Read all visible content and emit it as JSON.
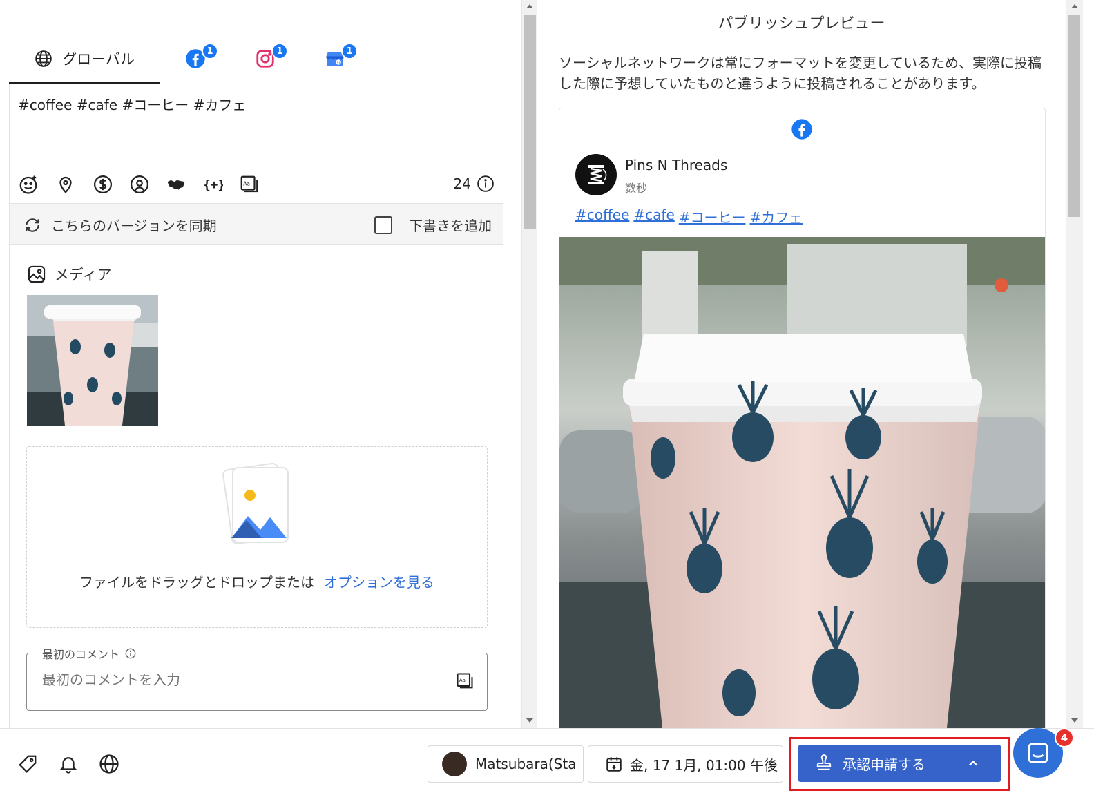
{
  "tabs": {
    "global_label": "グローバル",
    "facebook_badge": "1",
    "instagram_badge": "1",
    "google_badge": "1"
  },
  "editor": {
    "post_text": "#coffee #cafe #コーヒー #カフェ",
    "char_count": "24",
    "sync_label": "こちらのバージョンを同期",
    "draft_label": "下書きを追加",
    "media_label": "メディア",
    "drop_text": "ファイルをドラッグとドロップまたは",
    "drop_link": "オプションを見る",
    "comment_legend": "最初のコメント",
    "comment_placeholder": "最初のコメントを入力"
  },
  "preview": {
    "title": "パブリッシュプレビュー",
    "note": "ソーシャルネットワークは常にフォーマットを変更しているため、実際に投稿した際に予想していたものと違うように投稿されることがあります。",
    "page_name": "Pins N Threads",
    "time": "数秒",
    "hashtags": [
      "#coffee",
      "#cafe",
      "#コーヒー",
      "#カフェ"
    ]
  },
  "bottom": {
    "user_name": "Matsubara(Sta",
    "schedule": "金, 17 1月, 01:00 午後",
    "approve_label": "承認申請する",
    "chat_badge": "4"
  },
  "colors": {
    "accent": "#3563c9",
    "link": "#2f6fd8",
    "facebook": "#1877f2",
    "highlight": "#e31b23"
  },
  "icons": [
    "globe-icon",
    "facebook-icon",
    "instagram-icon",
    "google-business-icon",
    "emoji-icon",
    "location-icon",
    "dollar-icon",
    "podcast-icon",
    "handshake-icon",
    "variable-icon",
    "text-format-icon",
    "info-icon",
    "sync-icon",
    "image-icon",
    "tag-icon",
    "bell-icon",
    "calendar-icon",
    "stamp-icon",
    "chevron-up-icon",
    "chat-icon"
  ]
}
